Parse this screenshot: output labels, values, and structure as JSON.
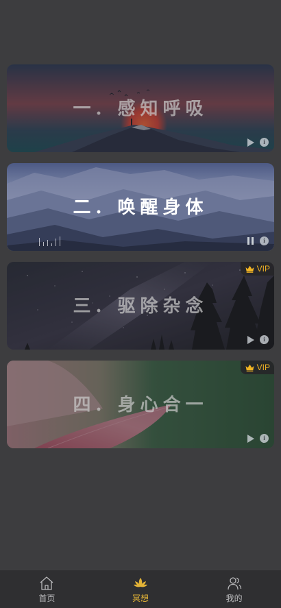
{
  "cards": [
    {
      "title": "一. 感知呼吸",
      "locked": false,
      "state": "play",
      "badge": ""
    },
    {
      "title": "二. 唤醒身体",
      "locked": false,
      "state": "pause",
      "badge": ""
    },
    {
      "title": "三. 驱除杂念",
      "locked": true,
      "state": "play",
      "badge": "VIP"
    },
    {
      "title": "四. 身心合一",
      "locked": true,
      "state": "play",
      "badge": "VIP"
    }
  ],
  "tabbar": {
    "home_label": "首页",
    "meditate_label": "冥想",
    "mine_label": "我的",
    "active_tab": "meditate"
  },
  "colors": {
    "background": "#3d3d3f",
    "accent": "#e4b437",
    "vip": "#f0b323",
    "tabbar": "#2f2f31"
  }
}
